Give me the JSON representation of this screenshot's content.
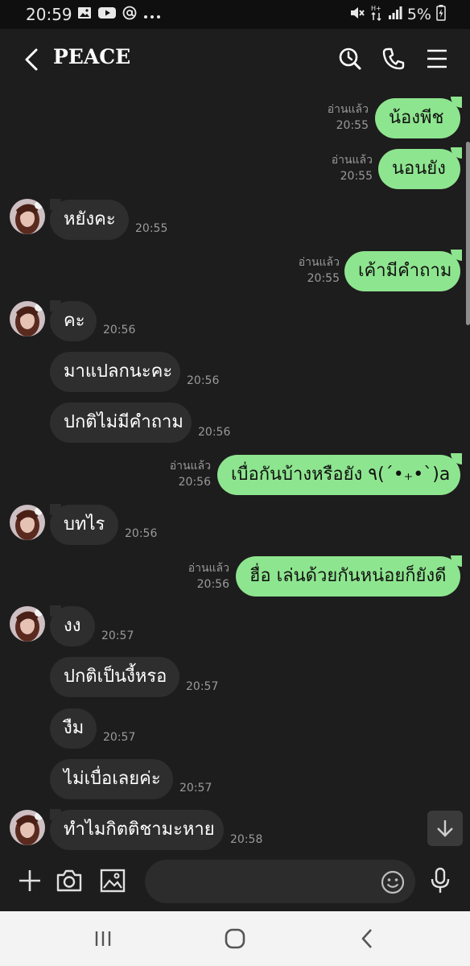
{
  "status_bar": {
    "time": "20:59",
    "left_icons": [
      "gallery-icon",
      "youtube-icon",
      "at-icon",
      "more-dots-icon"
    ],
    "right_icons": [
      "mute-icon",
      "data-arrows-icon",
      "signal-icon",
      "battery-charging-icon"
    ],
    "network": "H+",
    "battery": "5%"
  },
  "header": {
    "title": "PEACE",
    "icons": [
      "back-icon",
      "search-icon",
      "phone-icon",
      "menu-icon"
    ]
  },
  "messages": [
    {
      "side": "out",
      "text": "น้องพีช",
      "read": "อ่านแล้ว",
      "time": "20:55"
    },
    {
      "side": "out",
      "text": "นอนยัง",
      "read": "อ่านแล้ว",
      "time": "20:55"
    },
    {
      "side": "in",
      "text": "หยังคะ",
      "time": "20:55"
    },
    {
      "side": "out",
      "text": "เค้ามีคำถาม",
      "read": "อ่านแล้ว",
      "time": "20:55"
    },
    {
      "side": "in",
      "text": "คะ",
      "time": "20:56"
    },
    {
      "side": "in",
      "text": "มาแปลกนะคะ",
      "time": "20:56"
    },
    {
      "side": "in",
      "text": "ปกติไม่มีคำถาม",
      "time": "20:56"
    },
    {
      "side": "out",
      "text": "เบื่อกันบ้างหรือยัง ٩(´•₊•`)a",
      "read": "อ่านแล้ว",
      "time": "20:56"
    },
    {
      "side": "in",
      "text": "บทไร",
      "time": "20:56"
    },
    {
      "side": "out",
      "text": "ฮื่อ เล่นด้วยกันหน่อยก็ยังดี",
      "read": "อ่านแล้ว",
      "time": "20:56"
    },
    {
      "side": "in",
      "text": "งง",
      "time": "20:57"
    },
    {
      "side": "in",
      "text": "ปกติเป็นงี้หรอ",
      "time": "20:57"
    },
    {
      "side": "in",
      "text": "งืม",
      "time": "20:57"
    },
    {
      "side": "in",
      "text": "ไม่เบื่อเลยค่ะ",
      "time": "20:57"
    },
    {
      "side": "in",
      "text": "ทำไมกิตติชามะหาย",
      "time": "20:58"
    }
  ],
  "input_bar": {
    "placeholder": "",
    "icons": [
      "plus-icon",
      "camera-icon",
      "image-icon",
      "emoji-icon",
      "mic-icon"
    ]
  },
  "scroll_down_icon": "arrow-down-icon",
  "nav_bar": {
    "icons": [
      "recent-apps-icon",
      "home-icon",
      "nav-back-icon"
    ]
  },
  "colors": {
    "background": "#1d1d1d",
    "outgoing_bubble": "#8ee58f",
    "incoming_bubble": "#2e2e2e",
    "meta_text": "#9a9a9a",
    "nav_bar": "#f3f3f3"
  }
}
